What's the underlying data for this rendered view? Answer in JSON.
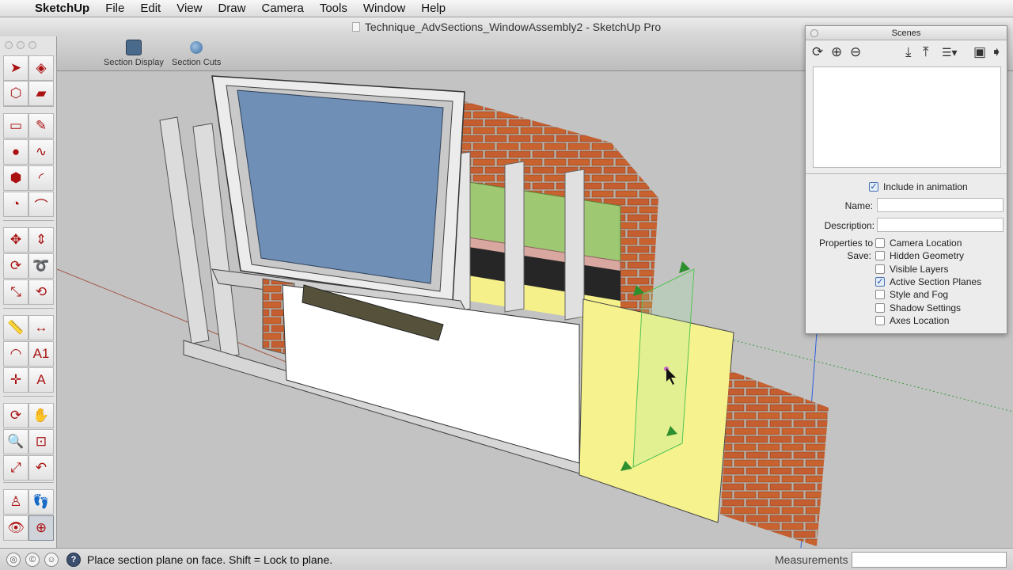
{
  "menubar": {
    "apple": "",
    "items": [
      "SketchUp",
      "File",
      "Edit",
      "View",
      "Draw",
      "Camera",
      "Tools",
      "Window",
      "Help"
    ]
  },
  "window": {
    "title": "Technique_AdvSections_WindowAssembly2 - SketchUp Pro"
  },
  "toolbar": {
    "section_display": "Section Display",
    "section_cuts": "Section Cuts"
  },
  "tools": {
    "select-tool": "➤",
    "paint-bucket-tool": "◈",
    "make-component-tool": "⬡",
    "eraser-tool": "▰",
    "rectangle-tool": "▭",
    "pencil-tool": "✎",
    "circle-tool": "●",
    "freehand-tool": "∿",
    "polygon-tool": "⬢",
    "arc-tool": "◜",
    "pie-tool": "◔",
    "two-point-arc-tool": "⌒",
    "move-tool": "✥",
    "push-pull-tool": "⇕",
    "rotate-tool": "⟳",
    "follow-me-tool": "➰",
    "scale-tool": "⤡",
    "offset-tool": "⟲",
    "tape-measure-tool": "📏",
    "dimension-tool": "↔",
    "protractor-tool": "◠",
    "text-tool": "A1",
    "axes-tool": "✛",
    "3d-text-tool": "A",
    "orbit-tool": "⟳",
    "pan-tool": "✋",
    "zoom-tool": "🔍",
    "zoom-window-tool": "⊡",
    "zoom-extents-tool": "⤢",
    "previous-view-tool": "↶",
    "position-camera-tool": "♙",
    "walk-tool": "👣",
    "look-around-tool": "👁",
    "section-plane-tool": "⊕"
  },
  "scenes_panel": {
    "title": "Scenes",
    "include_in_animation": "Include in animation",
    "name_label": "Name:",
    "description_label": "Description:",
    "properties_label_1": "Properties to",
    "properties_label_2": "Save:",
    "properties": [
      {
        "label": "Camera Location",
        "checked": false
      },
      {
        "label": "Hidden Geometry",
        "checked": false
      },
      {
        "label": "Visible Layers",
        "checked": false
      },
      {
        "label": "Active Section Planes",
        "checked": true
      },
      {
        "label": "Style and Fog",
        "checked": false
      },
      {
        "label": "Shadow Settings",
        "checked": false
      },
      {
        "label": "Axes Location",
        "checked": false
      }
    ]
  },
  "statusbar": {
    "message": "Place section plane on face.  Shift = Lock to plane.",
    "measurements_label": "Measurements",
    "measurements_value": ""
  }
}
